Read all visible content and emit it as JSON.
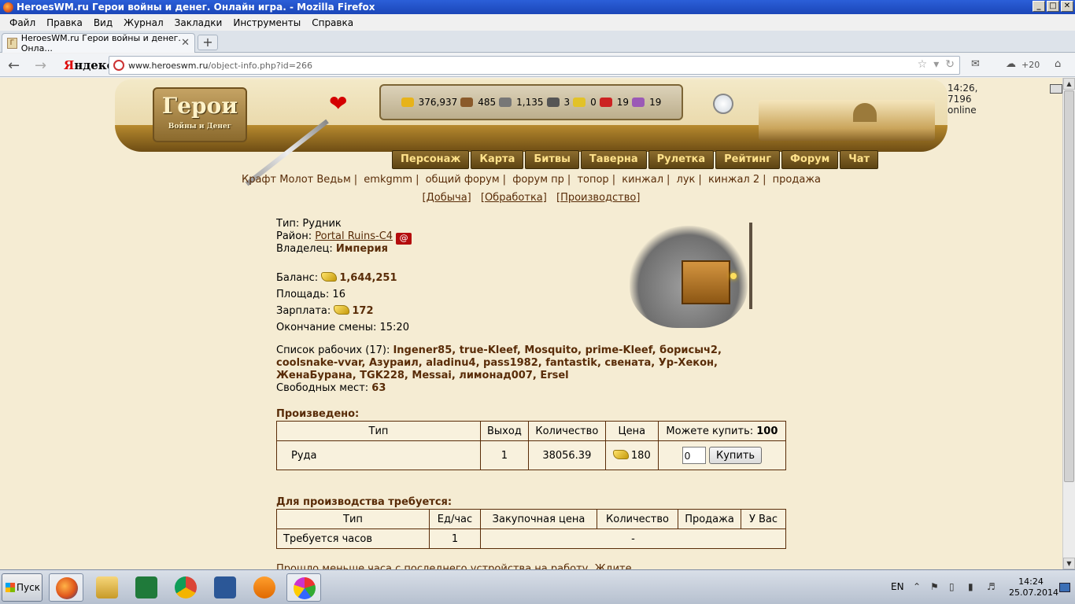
{
  "window": {
    "title": "HeroesWM.ru Герои войны и денег. Онлайн игра. - Mozilla Firefox",
    "buttons": [
      "_",
      "□",
      "✕"
    ]
  },
  "menu": [
    "Файл",
    "Правка",
    "Вид",
    "Журнал",
    "Закладки",
    "Инструменты",
    "Справка"
  ],
  "tab": {
    "title": "HeroesWM.ru Герои войны и денег. Онла...",
    "close": "✕",
    "new_tab": "+"
  },
  "nav": {
    "yandex_red": "Я",
    "yandex_rest": "ндекс",
    "url_host": "www.heroeswm.ru",
    "url_path": "/object-info.php?id=266",
    "weather": "+20"
  },
  "header": {
    "logo_main": "Герои",
    "logo_sub": "Войны и Денег",
    "time_online": "14:26, 7196 online",
    "resources": [
      {
        "icon": "gold-icon",
        "value": "376,937",
        "color": "#e7b31a"
      },
      {
        "icon": "wood-icon",
        "value": "485",
        "color": "#8a5a2b"
      },
      {
        "icon": "ore-icon",
        "value": "1,135",
        "color": "#777777"
      },
      {
        "icon": "mercury-icon",
        "value": "3",
        "color": "#555555"
      },
      {
        "icon": "sulfur-icon",
        "value": "0",
        "color": "#e2c228"
      },
      {
        "icon": "crystal-icon",
        "value": "19",
        "color": "#cc2222"
      },
      {
        "icon": "gems-icon",
        "value": "19",
        "color": "#9b59b6"
      }
    ]
  },
  "main_nav": [
    "Персонаж",
    "Карта",
    "Битвы",
    "Таверна",
    "Рулетка",
    "Рейтинг",
    "Форум",
    "Чат"
  ],
  "sub_nav": [
    "Крафт Молот Ведьм",
    "emkgmm",
    "общий форум",
    "форум пр",
    "топор",
    "кинжал",
    "лук",
    "кинжал 2",
    "продажа"
  ],
  "sub_nav2": [
    "[Добыча]",
    "[Обработка]",
    "[Производство]"
  ],
  "object": {
    "type_label": "Тип:",
    "type_value": "Рудник",
    "district_label": "Район:",
    "district_value": "Portal Ruins-C4",
    "owner_label": "Владелец:",
    "owner_value": "Империя",
    "balance_label": "Баланс:",
    "balance_value": "1,644,251",
    "area_label": "Площадь:",
    "area_value": "16",
    "salary_label": "Зарплата:",
    "salary_value": "172",
    "shift_label": "Окончание смены:",
    "shift_value": "15:20",
    "workers_label": "Список рабочих (17):",
    "workers_line1": "Ingener85, true-Kleef, Mosquito, prime-Kleef, борисыч2,",
    "workers_line2": "coolsnake-vvar, Азуpаил, aladinu4, pass1982, fantastik, свената, Ур-Хекон,",
    "workers_line3": "ЖенаБурана, TGK228, Messai, лимонад007, Ersel",
    "free_label": "Свободных мест:",
    "free_value": "63"
  },
  "produced": {
    "title": "Произведено:",
    "headers": [
      "Тип",
      "Выход",
      "Количество",
      "Цена"
    ],
    "can_buy_label": "Можете купить:",
    "can_buy_value": "100",
    "row": {
      "type": "Руда",
      "output": "1",
      "quantity": "38056.39",
      "price": "180"
    },
    "input_value": "0",
    "buy_button": "Купить"
  },
  "required": {
    "title": "Для производства требуется:",
    "headers": [
      "Тип",
      "Ед/час",
      "Закупочная цена",
      "Количество",
      "Продажа",
      "У Вас"
    ],
    "row": {
      "type": "Требуется часов",
      "per_hour": "1",
      "dash": "-"
    }
  },
  "cut_text": "Прошло меньше часа с последнего устройства на работу. Ждите...",
  "taskbar": {
    "start": "Пуск",
    "lang": "EN",
    "time": "14:24",
    "date": "25.07.2014"
  }
}
